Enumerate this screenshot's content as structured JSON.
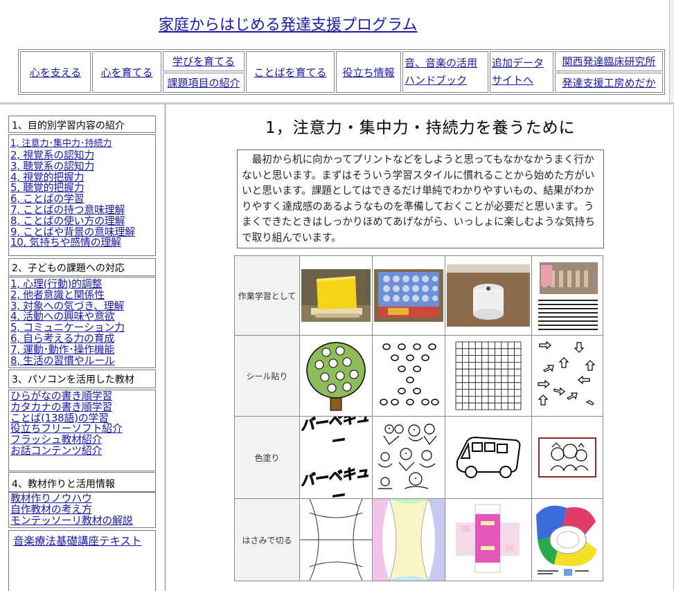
{
  "header": {
    "site_title": "家庭からはじめる発達支援プログラム",
    "nav": {
      "kokoro_sasaeru": "心を支える",
      "kokoro_sodateru": "心を育てる",
      "manabi_sodateru": "学びを育てる",
      "kadai_shoukai": "課題項目の紹介",
      "kotoba_sodateru": "ことばを育てる",
      "yakudachi": "役立ち情報",
      "ongaku": "音、音楽の活用",
      "handbook": "ハンドブック",
      "tsuika_data": "追加データ",
      "site_he": "サイトへ",
      "kansai": "関西発達臨床研究所",
      "medaka": "発達支援工房めだか"
    }
  },
  "sidebar": {
    "section1": {
      "heading": "1、目的別学習内容の紹介",
      "links": [
        "1, 注意力･集中力･持続力",
        "2, 視覚系の認知力",
        "3, 聴覚系の認知力",
        "4, 視覚的把握力",
        "5, 聴覚的把握力",
        "6, ことばの学習",
        "7, ことばの持つ意味理解",
        "8, ことばの使い方の理解",
        "9, ことばや背景の意味理解",
        "10, 気持ちや感情の理解"
      ]
    },
    "section2": {
      "heading": "2、子どもの課題への対応",
      "links": [
        "1, 心理(行動)的調整",
        "2, 他者意識と関係性",
        "3, 対象への気づき、理解",
        "4, 活動への興味や意欲",
        "5, コミュニケーション力",
        "6, 自ら考える力の育成",
        "7, 運動･動作･操作機能",
        "8, 生活の習慣やルール"
      ]
    },
    "section3": {
      "heading": "3、パソコンを活用した教材",
      "links": [
        "ひらがなの書き順学習",
        "カタカナの書き順学習",
        "ことば(138語)の学習",
        "役立ちフリーソフト紹介",
        "フラッシュ教材紹介",
        "お話コンテンツ紹介"
      ]
    },
    "section4": {
      "heading": "4、教材作りと活用情報",
      "links": [
        "教材作りノウハウ",
        "自作教材の考え方",
        "モンテッソーリ教材の解説"
      ]
    },
    "extra_link": "音楽療法基礎講座テキスト"
  },
  "main": {
    "title": "1，注意力・集中力・持続力を養うために",
    "intro": "最初から机に向かってプリントなどをしようと思ってもなかなかうまく行かないと思います。まずはそういう学習スタイルに慣れることから始めた方がいいと思います。課題としてはできるだけ単純でわかりやすいもの、結果がわかりやすく達成感のあるようなものを準備しておくことが必要だと思います。うまくできたときはしっかりほめてあげながら、いっしょに楽しむような気持ちで取り組んでいます。",
    "rows": [
      {
        "label": "作業学習として"
      },
      {
        "label": "シール貼り"
      },
      {
        "label": "色塗り",
        "image_text": "バーベキュー"
      },
      {
        "label": "はさみで切る"
      }
    ]
  }
}
